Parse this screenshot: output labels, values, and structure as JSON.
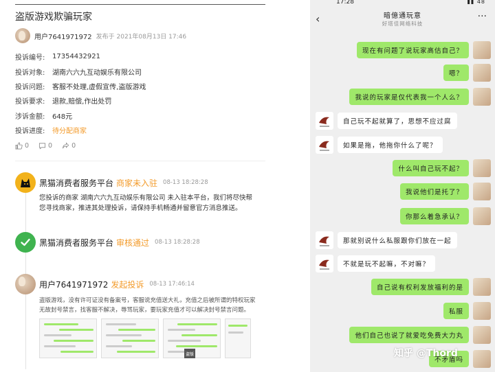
{
  "left": {
    "title": "盗版游戏欺骗玩家",
    "author": "用户7641971972",
    "published": "发布于 2021年08月13日 17:46",
    "fields": [
      {
        "label": "投诉编号:",
        "value": "17354432921",
        "highlight": false
      },
      {
        "label": "投诉对象:",
        "value": "湖南六六九互动娱乐有限公司",
        "highlight": false
      },
      {
        "label": "投诉问题:",
        "value": "客服不处理,虚假宣传,盗版游戏",
        "highlight": false
      },
      {
        "label": "投诉要求:",
        "value": "退款,赔偿,作出处罚",
        "highlight": false
      },
      {
        "label": "涉诉金额:",
        "value": "648元",
        "highlight": false
      },
      {
        "label": "投诉进度:",
        "value": "待分配商家",
        "highlight": true
      }
    ],
    "actions": {
      "like": "0",
      "comment": "0",
      "share": "0"
    },
    "timeline": [
      {
        "name": "黑猫消费者服务平台",
        "status": "商家未入驻",
        "time": "08-13 18:28:28",
        "body": "您投诉的商家 湖南六六九互动娱乐有限公司 未入驻本平台，我们将尽快帮您寻找商家，推进其处理投诉，请保持手机畅通并留意官方消息推送。"
      },
      {
        "name": "黑猫消费者服务平台",
        "status": "审核通过",
        "time": "08-13 18:28:28",
        "body": ""
      },
      {
        "name": "用户7641971972",
        "status": "发起投诉",
        "time": "08-13 17:46:14",
        "body": "盗版游戏，没有许可证没有备案号，客服说充值送大礼，充值之后被所谓的特权玩家无故封号禁言，找客服不解决，辱骂玩家，要玩家充值才可以解决封号禁言问题。"
      }
    ],
    "image_watermark": "盗版"
  },
  "phone": {
    "time": "17:28",
    "battery": "48",
    "title": "暗億通玩意",
    "subtitle": "好塔佳网络科技",
    "messages": [
      {
        "side": "out",
        "text": "现在有问题了说玩家高估自己？"
      },
      {
        "side": "out",
        "text": "嗯？"
      },
      {
        "side": "out",
        "text": "我说的玩家是仅代表我一个人么？"
      },
      {
        "side": "in",
        "text": "自己玩不起就算了，思想不应过腐"
      },
      {
        "side": "in",
        "text": "如果是拖，他拖你什么了呢？"
      },
      {
        "side": "out",
        "text": "什么叫自己玩不起？"
      },
      {
        "side": "out",
        "text": "我说他们是托了？"
      },
      {
        "side": "out",
        "text": "你那么着急承认？"
      },
      {
        "side": "in",
        "text": "那就别说什么私服跟你们放在一起"
      },
      {
        "side": "in",
        "text": "不就是玩不起嘛，不对嘛？"
      },
      {
        "side": "out",
        "text": "自己说有权利发放福利的是"
      },
      {
        "side": "out",
        "text": "私服"
      },
      {
        "side": "out",
        "text": "他们自己也说了就爱吃免费大力丸"
      },
      {
        "side": "out",
        "text": "不矛盾吗"
      }
    ],
    "watermark": "知乎 @Thord"
  }
}
